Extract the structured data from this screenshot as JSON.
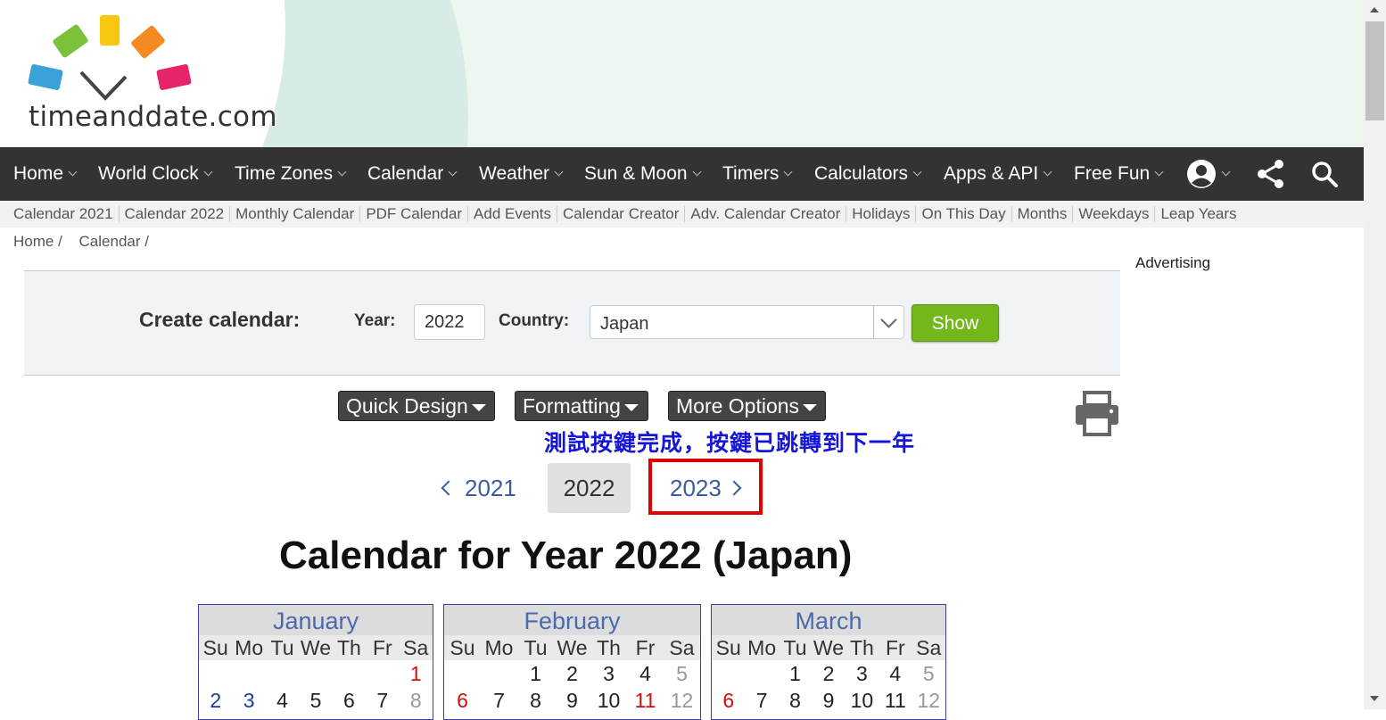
{
  "brand": {
    "logo_text": "timeanddate.com"
  },
  "nav": {
    "items": [
      "Home",
      "World Clock",
      "Time Zones",
      "Calendar",
      "Weather",
      "Sun & Moon",
      "Timers",
      "Calculators",
      "Apps & API",
      "Free Fun"
    ]
  },
  "subnav": {
    "items": [
      "Calendar 2021",
      "Calendar 2022",
      "Monthly Calendar",
      "PDF Calendar",
      "Add Events",
      "Calendar Creator",
      "Adv. Calendar Creator",
      "Holidays",
      "On This Day",
      "Months",
      "Weekdays",
      "Leap Years"
    ]
  },
  "breadcrumb": [
    "Home /",
    "Calendar /"
  ],
  "advertising_label": "Advertising",
  "form": {
    "title": "Create calendar:",
    "year_label": "Year:",
    "year_value": "2022",
    "country_label": "Country:",
    "country_value": "Japan",
    "show_label": "Show"
  },
  "options": {
    "quick_design": "Quick Design",
    "formatting": "Formatting",
    "more_options": "More Options"
  },
  "annotation": "測試按鍵完成，按鍵已跳轉到下一年",
  "year_nav": {
    "prev": "2021",
    "current": "2022",
    "next": "2023"
  },
  "calendar_title": "Calendar for Year 2022 (Japan)",
  "months": [
    {
      "name": "January",
      "dows": [
        "Su",
        "Mo",
        "Tu",
        "We",
        "Th",
        "Fr",
        "Sa"
      ],
      "week1": [
        "",
        "",
        "",
        "",
        "",
        "",
        "1"
      ],
      "week2": [
        "2",
        "3",
        "4",
        "5",
        "6",
        "7",
        "8"
      ]
    },
    {
      "name": "February",
      "dows": [
        "Su",
        "Mo",
        "Tu",
        "We",
        "Th",
        "Fr",
        "Sa"
      ],
      "week1": [
        "",
        "",
        "1",
        "2",
        "3",
        "4",
        "5"
      ],
      "week2": [
        "6",
        "7",
        "8",
        "9",
        "10",
        "11",
        "12"
      ]
    },
    {
      "name": "March",
      "dows": [
        "Su",
        "Mo",
        "Tu",
        "We",
        "Th",
        "Fr",
        "Sa"
      ],
      "week1": [
        "",
        "",
        "1",
        "2",
        "3",
        "4",
        "5"
      ],
      "week2": [
        "6",
        "7",
        "8",
        "9",
        "10",
        "11",
        "12"
      ]
    }
  ],
  "colors": {
    "nav_bg": "#333333",
    "show_button": "#74b71b",
    "highlight_box": "#e00000",
    "annotation": "#1616d6",
    "holiday": "#d01010",
    "link": "#3a5c9e"
  }
}
